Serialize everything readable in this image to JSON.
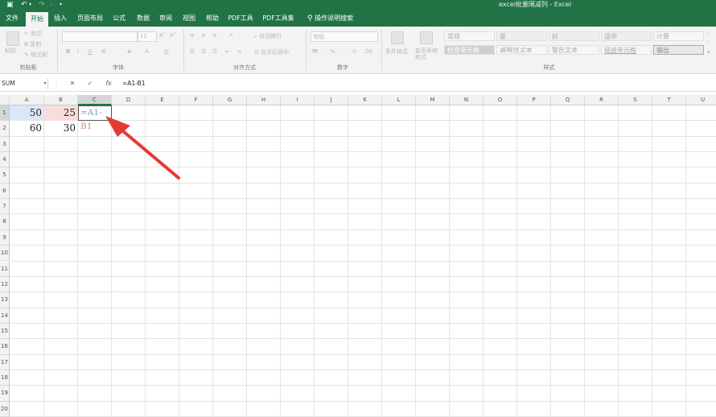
{
  "window": {
    "title": "excel批量隔减列 - Excel",
    "quick_access": [
      "save-icon",
      "undo-icon",
      "redo-icon",
      "customize-icon"
    ]
  },
  "tabs": [
    {
      "label": "文件",
      "active": false
    },
    {
      "label": "开始",
      "active": true
    },
    {
      "label": "插入",
      "active": false
    },
    {
      "label": "页面布局",
      "active": false
    },
    {
      "label": "公式",
      "active": false
    },
    {
      "label": "数据",
      "active": false
    },
    {
      "label": "审阅",
      "active": false
    },
    {
      "label": "视图",
      "active": false
    },
    {
      "label": "帮助",
      "active": false
    },
    {
      "label": "PDF工具",
      "active": false
    },
    {
      "label": "PDF工具集",
      "active": false
    }
  ],
  "tell_me": "操作说明搜索",
  "ribbon": {
    "clipboard": {
      "label": "剪贴板",
      "paste": "粘贴",
      "cut": "剪切",
      "copy": "复制",
      "format_painter": "格式刷"
    },
    "font": {
      "label": "字体",
      "size": "11",
      "bold": "B",
      "italic": "I",
      "underline": "U"
    },
    "alignment": {
      "label": "对齐方式",
      "wrap": "自动换行",
      "merge": "合并后居中"
    },
    "number": {
      "label": "数字",
      "format": "常规"
    },
    "styles": {
      "label": "样式",
      "conditional": "条件格式",
      "table_format": "套用表格格式",
      "cells": [
        [
          "常规",
          "差",
          "好",
          "适中",
          "计算"
        ],
        [
          "检查单元格",
          "解释性文本",
          "警告文本",
          "链接单元格",
          "输出"
        ]
      ]
    }
  },
  "formula_bar": {
    "name_box": "SUM",
    "cancel": "✕",
    "enter": "✓",
    "fx": "fx",
    "formula": "=A1-B1"
  },
  "sheet": {
    "columns": [
      "A",
      "B",
      "C",
      "D",
      "E",
      "F",
      "G",
      "H",
      "I",
      "J",
      "K",
      "L",
      "M",
      "N",
      "O",
      "P",
      "Q",
      "R",
      "S",
      "T",
      "U"
    ],
    "rows": [
      "1",
      "2",
      "3",
      "4",
      "5",
      "6",
      "7",
      "8",
      "9",
      "10",
      "11",
      "12",
      "13",
      "14",
      "15",
      "16",
      "17",
      "18",
      "19",
      "20"
    ],
    "cells": {
      "A1": "50",
      "B1": "25",
      "C1_prefix": "=A1-",
      "C1_ref": "B1",
      "A2": "60",
      "B2": "30"
    },
    "active_cell": "C1"
  },
  "colors": {
    "brand": "#217346",
    "arrow": "#e53935"
  }
}
